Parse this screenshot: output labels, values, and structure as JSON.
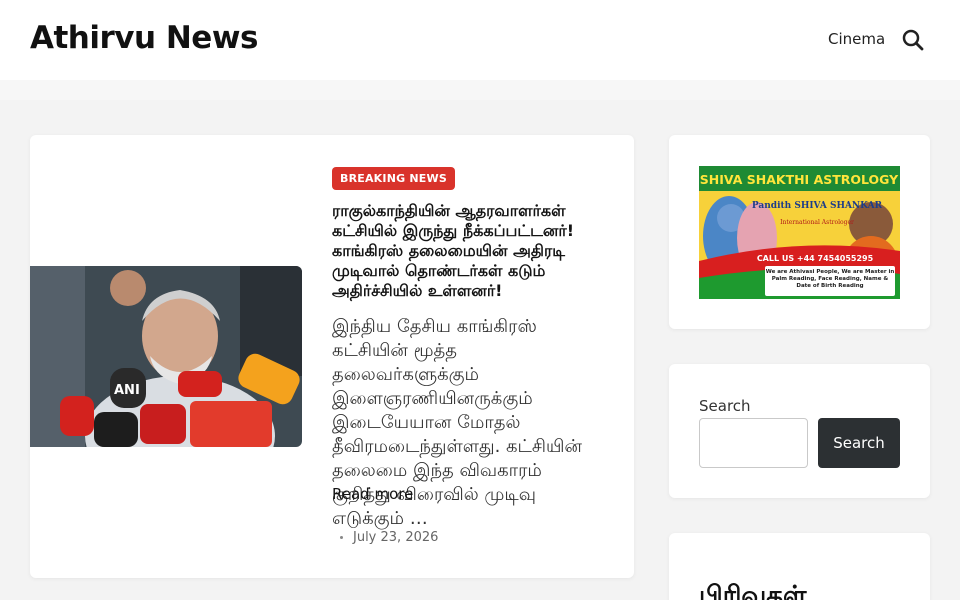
{
  "header": {
    "site_title": "Athirvu News",
    "nav": {
      "cinema": "Cinema"
    },
    "search_icon": "search-icon"
  },
  "post": {
    "category": "BREAKING NEWS",
    "title": "ராகுல்காந்தியின் ஆதரவாளர்கள் கட்சியில் இருந்து நீக்கப்பட்டனர்! காங்கிரஸ் தலைமையின் அதிரடி முடிவால் தொண்டர்கள் கடும் அதிர்ச்சியில் உள்ளனர்!",
    "excerpt": "இந்திய தேசிய காங்கிரஸ் கட்சியின் மூத்த தலைவர்களுக்கும் இளைஞரணியினருக்கும் இடையேயான மோதல் தீவிரமடைந்துள்ளது. கட்சியின் தலைமை இந்த விவகாரம் குறித்து விரைவில் முடிவு எடுக்கும் …",
    "read_more": "Read more",
    "date": "July 23, 2026",
    "badge_color": "#d9332b"
  },
  "sidebar": {
    "ad": {
      "title": "SHIVA SHAKTHI ASTROLOGY",
      "name": "Pandith SHIVA SHANKAR",
      "subtitle": "International Astrologer",
      "phone": "CALL US +44 7454055295",
      "tagline": "We are Athivasi People, We are Master in Palm Reading, Face Reading, Name & Date of Birth Reading"
    },
    "search": {
      "label": "Search",
      "placeholder": "",
      "button": "Search"
    },
    "categories": {
      "title": "பிரிவுகள்"
    }
  }
}
